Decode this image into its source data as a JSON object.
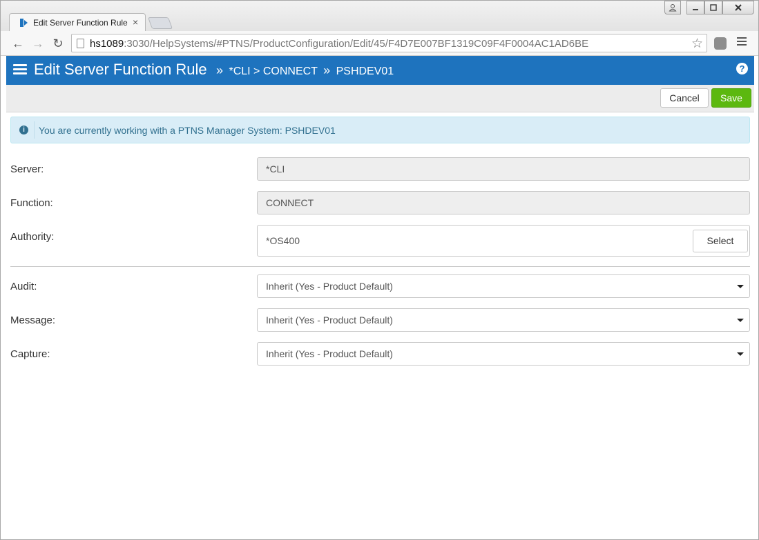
{
  "browser": {
    "tab_title": "Edit Server Function Rule",
    "tab_close": "×",
    "url_host": "hs1089",
    "url_rest": ":3030/HelpSystems/#PTNS/ProductConfiguration/Edit/45/F4D7E007BF1319C09F4F0004AC1AD6BE",
    "star": "☆",
    "back": "←",
    "forward": "→",
    "reload": "↻"
  },
  "header": {
    "title": "Edit Server Function Rule",
    "sep1": "»",
    "crumb1": "*CLI",
    "arrow": ">",
    "crumb2": "CONNECT",
    "sep2": "»",
    "crumb3": "PSHDEV01",
    "help": "?"
  },
  "actions": {
    "cancel": "Cancel",
    "save": "Save"
  },
  "alert": {
    "icon": "i",
    "text": "You are currently working with a PTNS Manager System: PSHDEV01"
  },
  "form": {
    "server_label": "Server:",
    "server_value": "*CLI",
    "function_label": "Function:",
    "function_value": "CONNECT",
    "authority_label": "Authority:",
    "authority_value": "*OS400",
    "select_label": "Select",
    "audit_label": "Audit:",
    "audit_value": "Inherit (Yes - Product Default)",
    "message_label": "Message:",
    "message_value": "Inherit (Yes - Product Default)",
    "capture_label": "Capture:",
    "capture_value": "Inherit (Yes - Product Default)"
  },
  "colors": {
    "header_bg": "#1e73be",
    "save_bg": "#5cb80f",
    "alert_bg": "#d9edf7"
  }
}
